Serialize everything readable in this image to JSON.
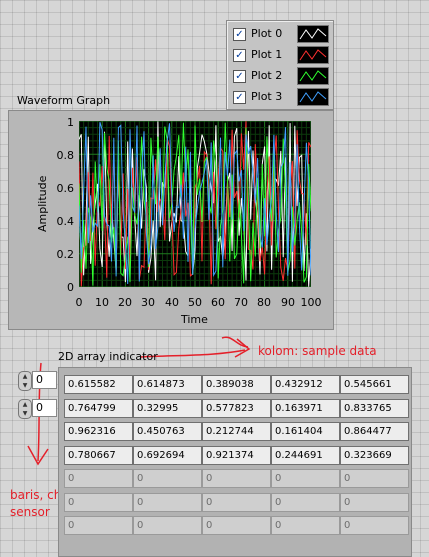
{
  "legend": {
    "items": [
      {
        "label": "Plot 0",
        "checked": true,
        "color": "#ffffff"
      },
      {
        "label": "Plot 1",
        "checked": true,
        "color": "#ff3030"
      },
      {
        "label": "Plot 2",
        "checked": true,
        "color": "#30ff30"
      },
      {
        "label": "Plot 3",
        "checked": true,
        "color": "#40a0ff"
      }
    ]
  },
  "graph": {
    "title": "Waveform Graph",
    "ylabel": "Amplitude",
    "xlabel": "Time",
    "yticks": [
      "1",
      "0.8",
      "0.6",
      "0.4",
      "0.2",
      "0"
    ],
    "xticks": [
      "0",
      "10",
      "20",
      "30",
      "40",
      "50",
      "60",
      "70",
      "80",
      "90",
      "100"
    ]
  },
  "chart_data": {
    "type": "line",
    "xlabel": "Time",
    "ylabel": "Amplitude",
    "xlim": [
      0,
      100
    ],
    "ylim": [
      0,
      1
    ],
    "grid": true,
    "legend_position": "top-right",
    "series": [
      {
        "name": "Plot 0",
        "color": "#ffffff"
      },
      {
        "name": "Plot 1",
        "color": "#ff3030"
      },
      {
        "name": "Plot 2",
        "color": "#30ff30"
      },
      {
        "name": "Plot 3",
        "color": "#40a0ff"
      }
    ]
  },
  "annotations": {
    "kolom": "kolom: sample data",
    "baris_line1": "baris, channel atau",
    "baris_line2": "sensor"
  },
  "array": {
    "label": "2D array indicator",
    "row_index": "0",
    "col_index": "0",
    "rows": [
      [
        "0.615582",
        "0.614873",
        "0.389038",
        "0.432912",
        "0.545661"
      ],
      [
        "0.764799",
        "0.32995",
        "0.577823",
        "0.163971",
        "0.833765"
      ],
      [
        "0.962316",
        "0.450763",
        "0.212744",
        "0.161404",
        "0.864477"
      ],
      [
        "0.780667",
        "0.692694",
        "0.921374",
        "0.244691",
        "0.323669"
      ],
      [
        "0",
        "0",
        "0",
        "0",
        "0"
      ],
      [
        "0",
        "0",
        "0",
        "0",
        "0"
      ],
      [
        "0",
        "0",
        "0",
        "0",
        "0"
      ]
    ]
  }
}
